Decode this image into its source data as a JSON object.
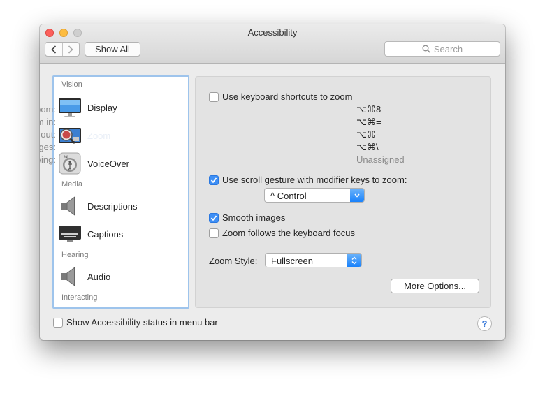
{
  "window": {
    "title": "Accessibility"
  },
  "toolbar": {
    "show_all": "Show All",
    "search_placeholder": "Search"
  },
  "sidebar": {
    "sections": [
      {
        "header": "Vision",
        "items": [
          {
            "label": "Display",
            "icon": "display-icon"
          },
          {
            "label": "Zoom",
            "icon": "zoom-icon",
            "selected": true
          },
          {
            "label": "VoiceOver",
            "icon": "voiceover-icon"
          }
        ]
      },
      {
        "header": "Media",
        "items": [
          {
            "label": "Descriptions",
            "icon": "speaker-icon"
          },
          {
            "label": "Captions",
            "icon": "captions-icon"
          }
        ]
      },
      {
        "header": "Hearing",
        "items": [
          {
            "label": "Audio",
            "icon": "speaker-icon"
          }
        ]
      },
      {
        "header": "Interacting",
        "items": []
      }
    ]
  },
  "pane": {
    "keyboard_shortcuts": {
      "label": "Use keyboard shortcuts to zoom",
      "checked": false
    },
    "shortcuts": [
      {
        "label": "Toggle zoom:",
        "value": "⌥⌘8"
      },
      {
        "label": "Zoom in:",
        "value": "⌥⌘="
      },
      {
        "label": "Zoom out:",
        "value": "⌥⌘-"
      },
      {
        "label": "Toggle smooth images:",
        "value": "⌥⌘\\"
      },
      {
        "label": "Toggle keyboard focus following:",
        "value": "Unassigned"
      }
    ],
    "scroll_gesture": {
      "label": "Use scroll gesture with modifier keys to zoom:",
      "checked": true
    },
    "modifier_key": {
      "value": "^ Control"
    },
    "smooth_images": {
      "label": "Smooth images",
      "checked": true
    },
    "follow_focus": {
      "label": "Zoom follows the keyboard focus",
      "checked": false
    },
    "zoom_style": {
      "label": "Zoom Style:",
      "value": "Fullscreen"
    },
    "more_options": "More Options..."
  },
  "footer": {
    "status_menu": {
      "label": "Show Accessibility status in menu bar",
      "checked": false
    },
    "help": "?"
  },
  "colors": {
    "accent": "#3e8ff5",
    "selection_ring": "#9ec4ec",
    "popup_arrow": "#1a82fb"
  }
}
